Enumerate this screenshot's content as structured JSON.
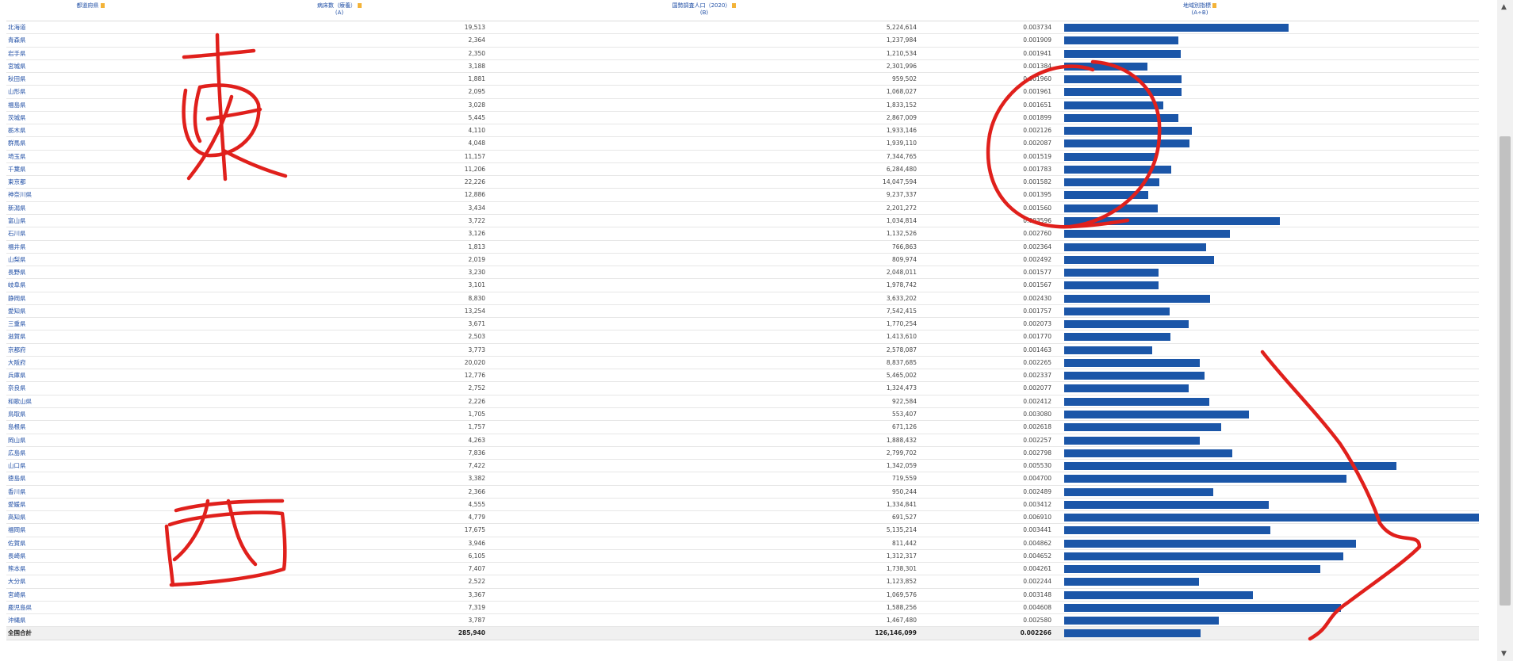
{
  "table": {
    "headers": {
      "pref": "都道府県",
      "a": "病床数（療養）",
      "a_sub": "(A)",
      "b": "国勢調査人口（2020）",
      "b_sub": "(B)",
      "ratio": "地域別指標",
      "ratio_sub": "(A÷B)"
    },
    "total": {
      "label": "全国合計",
      "a": "285,940",
      "b": "126,146,099",
      "ratio": "0.002266"
    }
  },
  "chart_data": {
    "type": "bar",
    "orientation": "horizontal",
    "categories": [
      "北海道",
      "青森県",
      "岩手県",
      "宮城県",
      "秋田県",
      "山形県",
      "福島県",
      "茨城県",
      "栃木県",
      "群馬県",
      "埼玉県",
      "千葉県",
      "東京都",
      "神奈川県",
      "新潟県",
      "富山県",
      "石川県",
      "福井県",
      "山梨県",
      "長野県",
      "岐阜県",
      "静岡県",
      "愛知県",
      "三重県",
      "滋賀県",
      "京都府",
      "大阪府",
      "兵庫県",
      "奈良県",
      "和歌山県",
      "鳥取県",
      "島根県",
      "岡山県",
      "広島県",
      "山口県",
      "徳島県",
      "香川県",
      "愛媛県",
      "高知県",
      "福岡県",
      "佐賀県",
      "長崎県",
      "熊本県",
      "大分県",
      "宮崎県",
      "鹿児島県",
      "沖縄県"
    ],
    "a_text": [
      "19,513",
      "2,364",
      "2,350",
      "3,188",
      "1,881",
      "2,095",
      "3,028",
      "5,445",
      "4,110",
      "4,048",
      "11,157",
      "11,206",
      "22,226",
      "12,886",
      "3,434",
      "3,722",
      "3,126",
      "1,813",
      "2,019",
      "3,230",
      "3,101",
      "8,830",
      "13,254",
      "3,671",
      "2,503",
      "3,773",
      "20,020",
      "12,776",
      "2,752",
      "2,226",
      "1,705",
      "1,757",
      "4,263",
      "7,836",
      "7,422",
      "3,382",
      "2,366",
      "4,555",
      "4,779",
      "17,675",
      "3,946",
      "6,105",
      "7,407",
      "2,522",
      "3,367",
      "7,319",
      "3,787"
    ],
    "b_text": [
      "5,224,614",
      "1,237,984",
      "1,210,534",
      "2,301,996",
      "959,502",
      "1,068,027",
      "1,833,152",
      "2,867,009",
      "1,933,146",
      "1,939,110",
      "7,344,765",
      "6,284,480",
      "14,047,594",
      "9,237,337",
      "2,201,272",
      "1,034,814",
      "1,132,526",
      "766,863",
      "809,974",
      "2,048,011",
      "1,978,742",
      "3,633,202",
      "7,542,415",
      "1,770,254",
      "1,413,610",
      "2,578,087",
      "8,837,685",
      "5,465,002",
      "1,324,473",
      "922,584",
      "553,407",
      "671,126",
      "1,888,432",
      "2,799,702",
      "1,342,059",
      "719,559",
      "950,244",
      "1,334,841",
      "691,527",
      "5,135,214",
      "811,442",
      "1,312,317",
      "1,738,301",
      "1,123,852",
      "1,069,576",
      "1,588,256",
      "1,467,480"
    ],
    "values": [
      0.003734,
      0.001909,
      0.001941,
      0.001384,
      0.00196,
      0.001961,
      0.001651,
      0.001899,
      0.002126,
      0.002087,
      0.001519,
      0.001783,
      0.001582,
      0.001395,
      0.00156,
      0.003596,
      0.00276,
      0.002364,
      0.002492,
      0.001577,
      0.001567,
      0.00243,
      0.001757,
      0.002073,
      0.00177,
      0.001463,
      0.002265,
      0.002337,
      0.002077,
      0.002412,
      0.00308,
      0.002618,
      0.002257,
      0.002798,
      0.00553,
      0.0047,
      0.002489,
      0.003412,
      0.00691,
      0.003441,
      0.004862,
      0.004652,
      0.004261,
      0.002244,
      0.003148,
      0.004608,
      0.00258
    ],
    "total_value": 0.002266,
    "xlim": [
      0,
      0.00691
    ]
  },
  "annotations": [
    "東",
    "西"
  ],
  "scrollbar": {
    "up": "▲",
    "down": "▼"
  }
}
